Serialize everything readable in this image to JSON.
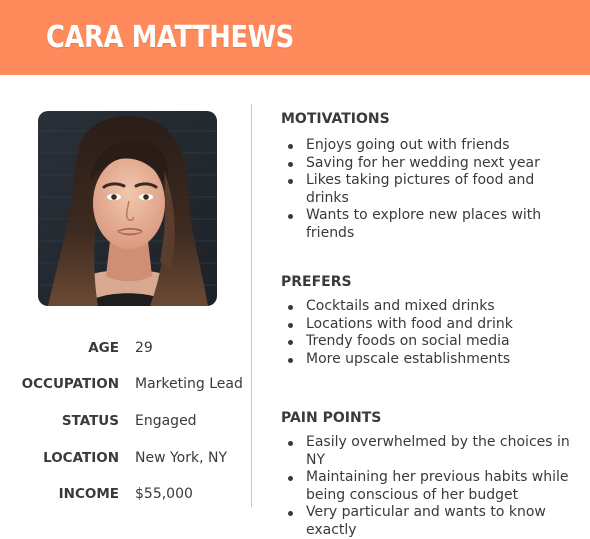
{
  "header": {
    "name": "CARA MATTHEWS",
    "color": "#ff8a5b"
  },
  "profile": {
    "photo_alt": "portrait-photo",
    "fields": [
      {
        "label": "AGE",
        "value": "29"
      },
      {
        "label": "OCCUPATION",
        "value": "Marketing Lead"
      },
      {
        "label": "STATUS",
        "value": "Engaged"
      },
      {
        "label": "LOCATION",
        "value": "New York, NY"
      },
      {
        "label": "INCOME",
        "value": "$55,000"
      }
    ]
  },
  "sections": {
    "motivations": {
      "title": "MOTIVATIONS",
      "items": [
        "Enjoys going out with friends",
        "Saving for her wedding next year",
        "Likes taking pictures of food and drinks",
        "Wants to explore new places with friends"
      ]
    },
    "prefers": {
      "title": "PREFERS",
      "items": [
        "Cocktails and mixed drinks",
        "Locations with food and drink",
        "Trendy foods on social media",
        "More upscale establishments"
      ]
    },
    "pain_points": {
      "title": "PAIN POINTS",
      "items": [
        "Easily overwhelmed by the choices in NY",
        "Maintaining her previous habits while being conscious of her budget",
        "Very particular and wants to know exactly"
      ]
    }
  }
}
